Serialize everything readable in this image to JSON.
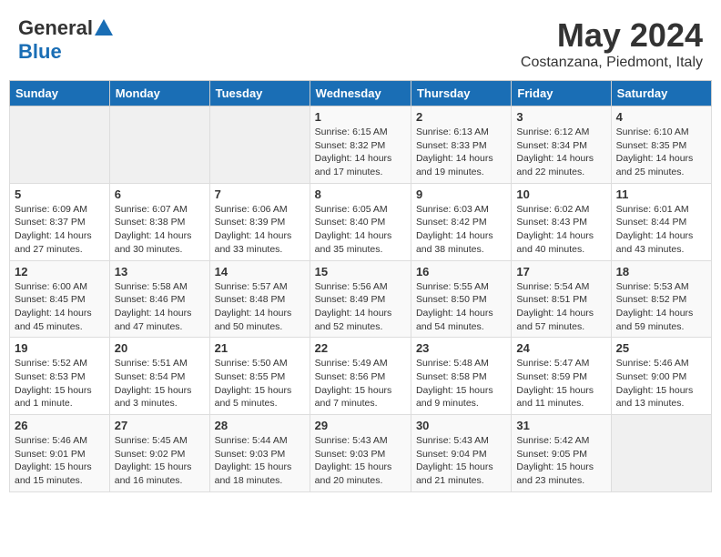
{
  "header": {
    "logo_general": "General",
    "logo_blue": "Blue",
    "month_year": "May 2024",
    "location": "Costanzana, Piedmont, Italy"
  },
  "days_of_week": [
    "Sunday",
    "Monday",
    "Tuesday",
    "Wednesday",
    "Thursday",
    "Friday",
    "Saturday"
  ],
  "weeks": [
    [
      {
        "day": "",
        "sunrise": "",
        "sunset": "",
        "daylight": ""
      },
      {
        "day": "",
        "sunrise": "",
        "sunset": "",
        "daylight": ""
      },
      {
        "day": "",
        "sunrise": "",
        "sunset": "",
        "daylight": ""
      },
      {
        "day": "1",
        "sunrise": "Sunrise: 6:15 AM",
        "sunset": "Sunset: 8:32 PM",
        "daylight": "Daylight: 14 hours and 17 minutes."
      },
      {
        "day": "2",
        "sunrise": "Sunrise: 6:13 AM",
        "sunset": "Sunset: 8:33 PM",
        "daylight": "Daylight: 14 hours and 19 minutes."
      },
      {
        "day": "3",
        "sunrise": "Sunrise: 6:12 AM",
        "sunset": "Sunset: 8:34 PM",
        "daylight": "Daylight: 14 hours and 22 minutes."
      },
      {
        "day": "4",
        "sunrise": "Sunrise: 6:10 AM",
        "sunset": "Sunset: 8:35 PM",
        "daylight": "Daylight: 14 hours and 25 minutes."
      }
    ],
    [
      {
        "day": "5",
        "sunrise": "Sunrise: 6:09 AM",
        "sunset": "Sunset: 8:37 PM",
        "daylight": "Daylight: 14 hours and 27 minutes."
      },
      {
        "day": "6",
        "sunrise": "Sunrise: 6:07 AM",
        "sunset": "Sunset: 8:38 PM",
        "daylight": "Daylight: 14 hours and 30 minutes."
      },
      {
        "day": "7",
        "sunrise": "Sunrise: 6:06 AM",
        "sunset": "Sunset: 8:39 PM",
        "daylight": "Daylight: 14 hours and 33 minutes."
      },
      {
        "day": "8",
        "sunrise": "Sunrise: 6:05 AM",
        "sunset": "Sunset: 8:40 PM",
        "daylight": "Daylight: 14 hours and 35 minutes."
      },
      {
        "day": "9",
        "sunrise": "Sunrise: 6:03 AM",
        "sunset": "Sunset: 8:42 PM",
        "daylight": "Daylight: 14 hours and 38 minutes."
      },
      {
        "day": "10",
        "sunrise": "Sunrise: 6:02 AM",
        "sunset": "Sunset: 8:43 PM",
        "daylight": "Daylight: 14 hours and 40 minutes."
      },
      {
        "day": "11",
        "sunrise": "Sunrise: 6:01 AM",
        "sunset": "Sunset: 8:44 PM",
        "daylight": "Daylight: 14 hours and 43 minutes."
      }
    ],
    [
      {
        "day": "12",
        "sunrise": "Sunrise: 6:00 AM",
        "sunset": "Sunset: 8:45 PM",
        "daylight": "Daylight: 14 hours and 45 minutes."
      },
      {
        "day": "13",
        "sunrise": "Sunrise: 5:58 AM",
        "sunset": "Sunset: 8:46 PM",
        "daylight": "Daylight: 14 hours and 47 minutes."
      },
      {
        "day": "14",
        "sunrise": "Sunrise: 5:57 AM",
        "sunset": "Sunset: 8:48 PM",
        "daylight": "Daylight: 14 hours and 50 minutes."
      },
      {
        "day": "15",
        "sunrise": "Sunrise: 5:56 AM",
        "sunset": "Sunset: 8:49 PM",
        "daylight": "Daylight: 14 hours and 52 minutes."
      },
      {
        "day": "16",
        "sunrise": "Sunrise: 5:55 AM",
        "sunset": "Sunset: 8:50 PM",
        "daylight": "Daylight: 14 hours and 54 minutes."
      },
      {
        "day": "17",
        "sunrise": "Sunrise: 5:54 AM",
        "sunset": "Sunset: 8:51 PM",
        "daylight": "Daylight: 14 hours and 57 minutes."
      },
      {
        "day": "18",
        "sunrise": "Sunrise: 5:53 AM",
        "sunset": "Sunset: 8:52 PM",
        "daylight": "Daylight: 14 hours and 59 minutes."
      }
    ],
    [
      {
        "day": "19",
        "sunrise": "Sunrise: 5:52 AM",
        "sunset": "Sunset: 8:53 PM",
        "daylight": "Daylight: 15 hours and 1 minute."
      },
      {
        "day": "20",
        "sunrise": "Sunrise: 5:51 AM",
        "sunset": "Sunset: 8:54 PM",
        "daylight": "Daylight: 15 hours and 3 minutes."
      },
      {
        "day": "21",
        "sunrise": "Sunrise: 5:50 AM",
        "sunset": "Sunset: 8:55 PM",
        "daylight": "Daylight: 15 hours and 5 minutes."
      },
      {
        "day": "22",
        "sunrise": "Sunrise: 5:49 AM",
        "sunset": "Sunset: 8:56 PM",
        "daylight": "Daylight: 15 hours and 7 minutes."
      },
      {
        "day": "23",
        "sunrise": "Sunrise: 5:48 AM",
        "sunset": "Sunset: 8:58 PM",
        "daylight": "Daylight: 15 hours and 9 minutes."
      },
      {
        "day": "24",
        "sunrise": "Sunrise: 5:47 AM",
        "sunset": "Sunset: 8:59 PM",
        "daylight": "Daylight: 15 hours and 11 minutes."
      },
      {
        "day": "25",
        "sunrise": "Sunrise: 5:46 AM",
        "sunset": "Sunset: 9:00 PM",
        "daylight": "Daylight: 15 hours and 13 minutes."
      }
    ],
    [
      {
        "day": "26",
        "sunrise": "Sunrise: 5:46 AM",
        "sunset": "Sunset: 9:01 PM",
        "daylight": "Daylight: 15 hours and 15 minutes."
      },
      {
        "day": "27",
        "sunrise": "Sunrise: 5:45 AM",
        "sunset": "Sunset: 9:02 PM",
        "daylight": "Daylight: 15 hours and 16 minutes."
      },
      {
        "day": "28",
        "sunrise": "Sunrise: 5:44 AM",
        "sunset": "Sunset: 9:03 PM",
        "daylight": "Daylight: 15 hours and 18 minutes."
      },
      {
        "day": "29",
        "sunrise": "Sunrise: 5:43 AM",
        "sunset": "Sunset: 9:03 PM",
        "daylight": "Daylight: 15 hours and 20 minutes."
      },
      {
        "day": "30",
        "sunrise": "Sunrise: 5:43 AM",
        "sunset": "Sunset: 9:04 PM",
        "daylight": "Daylight: 15 hours and 21 minutes."
      },
      {
        "day": "31",
        "sunrise": "Sunrise: 5:42 AM",
        "sunset": "Sunset: 9:05 PM",
        "daylight": "Daylight: 15 hours and 23 minutes."
      },
      {
        "day": "",
        "sunrise": "",
        "sunset": "",
        "daylight": ""
      }
    ]
  ]
}
